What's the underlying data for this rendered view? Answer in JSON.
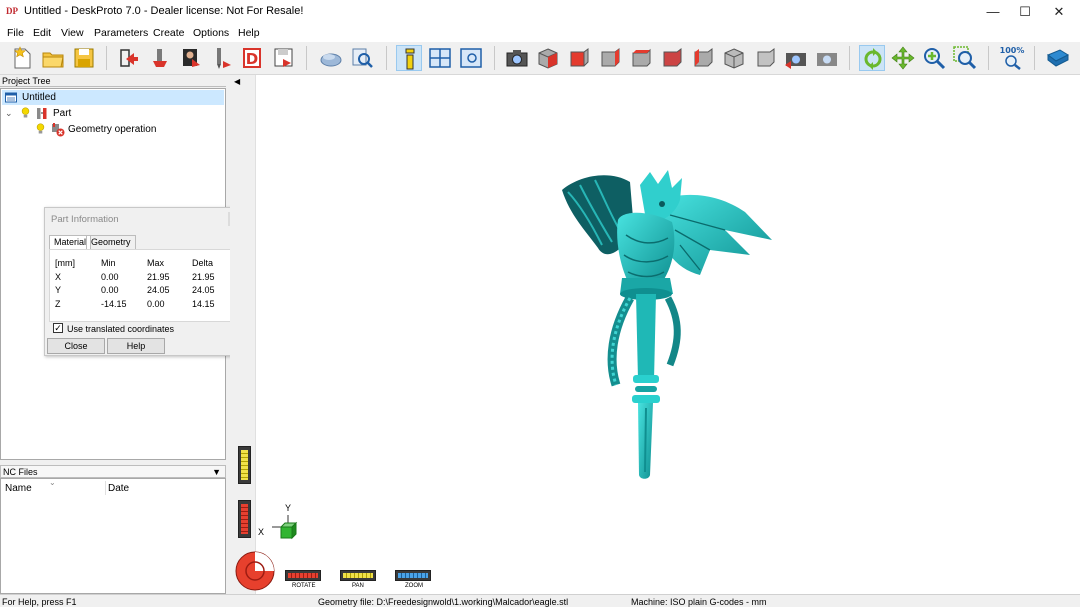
{
  "window": {
    "title": "Untitled - DeskProto 7.0 - Dealer license: Not For Resale!",
    "icon_text": "DP",
    "minimize": "—",
    "maximize": "☐",
    "close": "✕"
  },
  "menu": [
    "File",
    "Edit",
    "View",
    "Parameters",
    "Create",
    "Options",
    "Help"
  ],
  "toolbar": {
    "zoom_label": "100%",
    "active_tool": "part-information-button"
  },
  "project_tree": {
    "header": "Project Tree",
    "root": "Untitled",
    "part": "Part",
    "operation": "Geometry operation"
  },
  "nc_files": {
    "header": "NC Files",
    "columns": [
      "Name",
      "Date"
    ]
  },
  "part_info": {
    "title": "Part Information",
    "tabs": [
      "Material",
      "Geometry"
    ],
    "selected_tab": "Material",
    "headers": [
      "[mm]",
      "Min",
      "Max",
      "Delta"
    ],
    "rows": [
      {
        "axis": "X",
        "min": "0.00",
        "max": "21.95",
        "delta": "21.95"
      },
      {
        "axis": "Y",
        "min": "0.00",
        "max": "24.05",
        "delta": "24.05"
      },
      {
        "axis": "Z",
        "min": "-14.15",
        "max": "0.00",
        "delta": "14.15"
      }
    ],
    "checkbox_label": "Use translated coordinates",
    "checkbox_checked": true,
    "close_label": "Close",
    "help_label": "Help"
  },
  "viewport": {
    "axis_y": "Y",
    "axis_x": "X",
    "wheels": {
      "rotate": "ROTATE",
      "pan": "PAN",
      "zoom": "ZOOM"
    },
    "model_color": "#26c4c4"
  },
  "status": {
    "help": "For Help, press F1",
    "geometry": "Geometry file: D:\\Freedesignwold\\1.working\\Malcador\\eagle.stl",
    "machine": "Machine: ISO plain G-codes - mm"
  }
}
